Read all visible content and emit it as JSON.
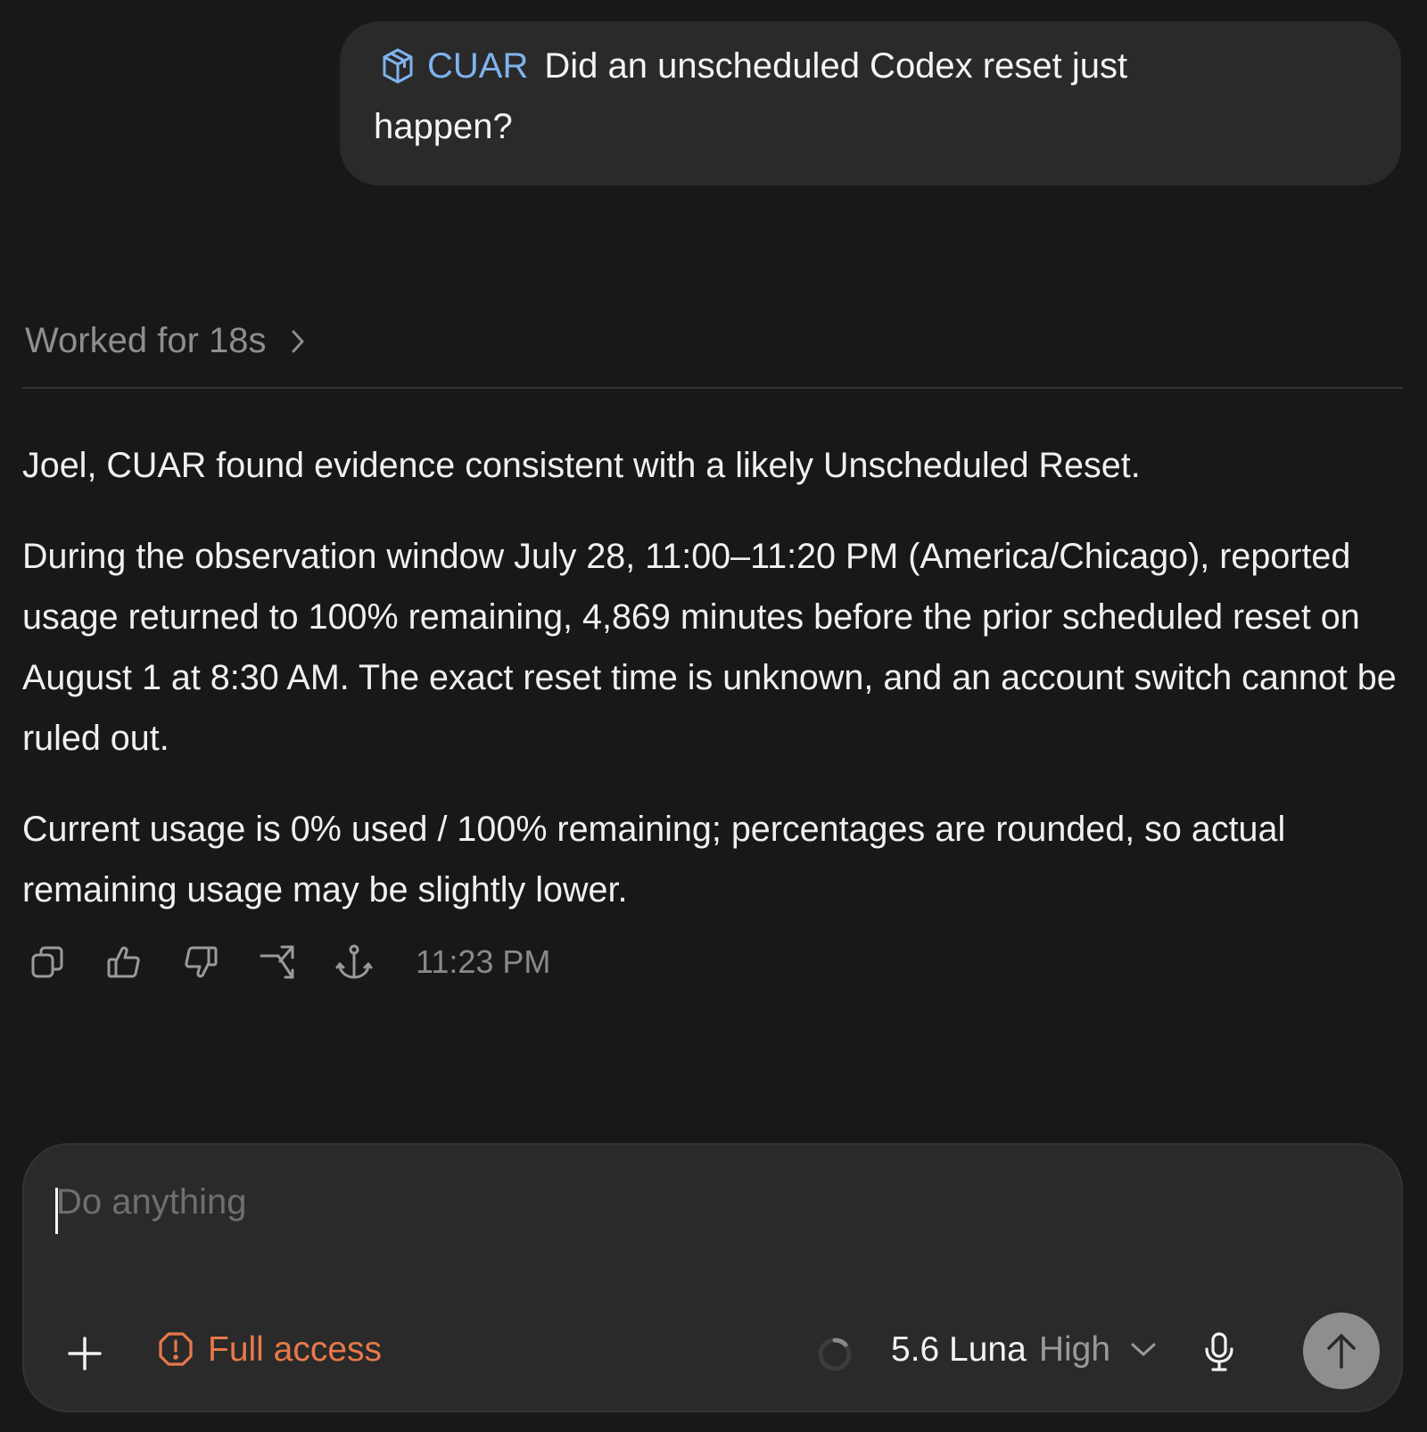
{
  "user_message": {
    "mention": "CUAR",
    "mention_icon": "cube-icon",
    "text_line1": "Did an unscheduled Codex reset just",
    "text_line2": "happen?"
  },
  "worked": {
    "label": "Worked for 18s"
  },
  "response": {
    "paragraphs": [
      "Joel, CUAR found evidence consistent with a likely Unscheduled Reset.",
      "During the observation window July 28, 11:00–11:20 PM (America/Chicago), reported usage returned to 100% remaining, 4,869 minutes before the prior scheduled reset on August 1 at 8:30 AM. The exact reset time is unknown, and an account switch cannot be ruled out.",
      "Current usage is 0% used / 100% remaining; percentages are rounded, so actual remaining usage may be slightly lower."
    ]
  },
  "actions": {
    "icons": [
      "copy-icon",
      "thumbs-up-icon",
      "thumbs-down-icon",
      "fork-icon",
      "anchor-icon"
    ],
    "timestamp": "11:23 PM"
  },
  "composer": {
    "placeholder": "Do anything",
    "value": "",
    "access_label": "Full access",
    "model_name": "5.6 Luna",
    "model_level": "High"
  },
  "colors": {
    "background": "#181818",
    "bubble": "#2a2a2a",
    "mention": "#7fb3ee",
    "access": "#e8794a",
    "send_button": "#8e8e8e"
  }
}
